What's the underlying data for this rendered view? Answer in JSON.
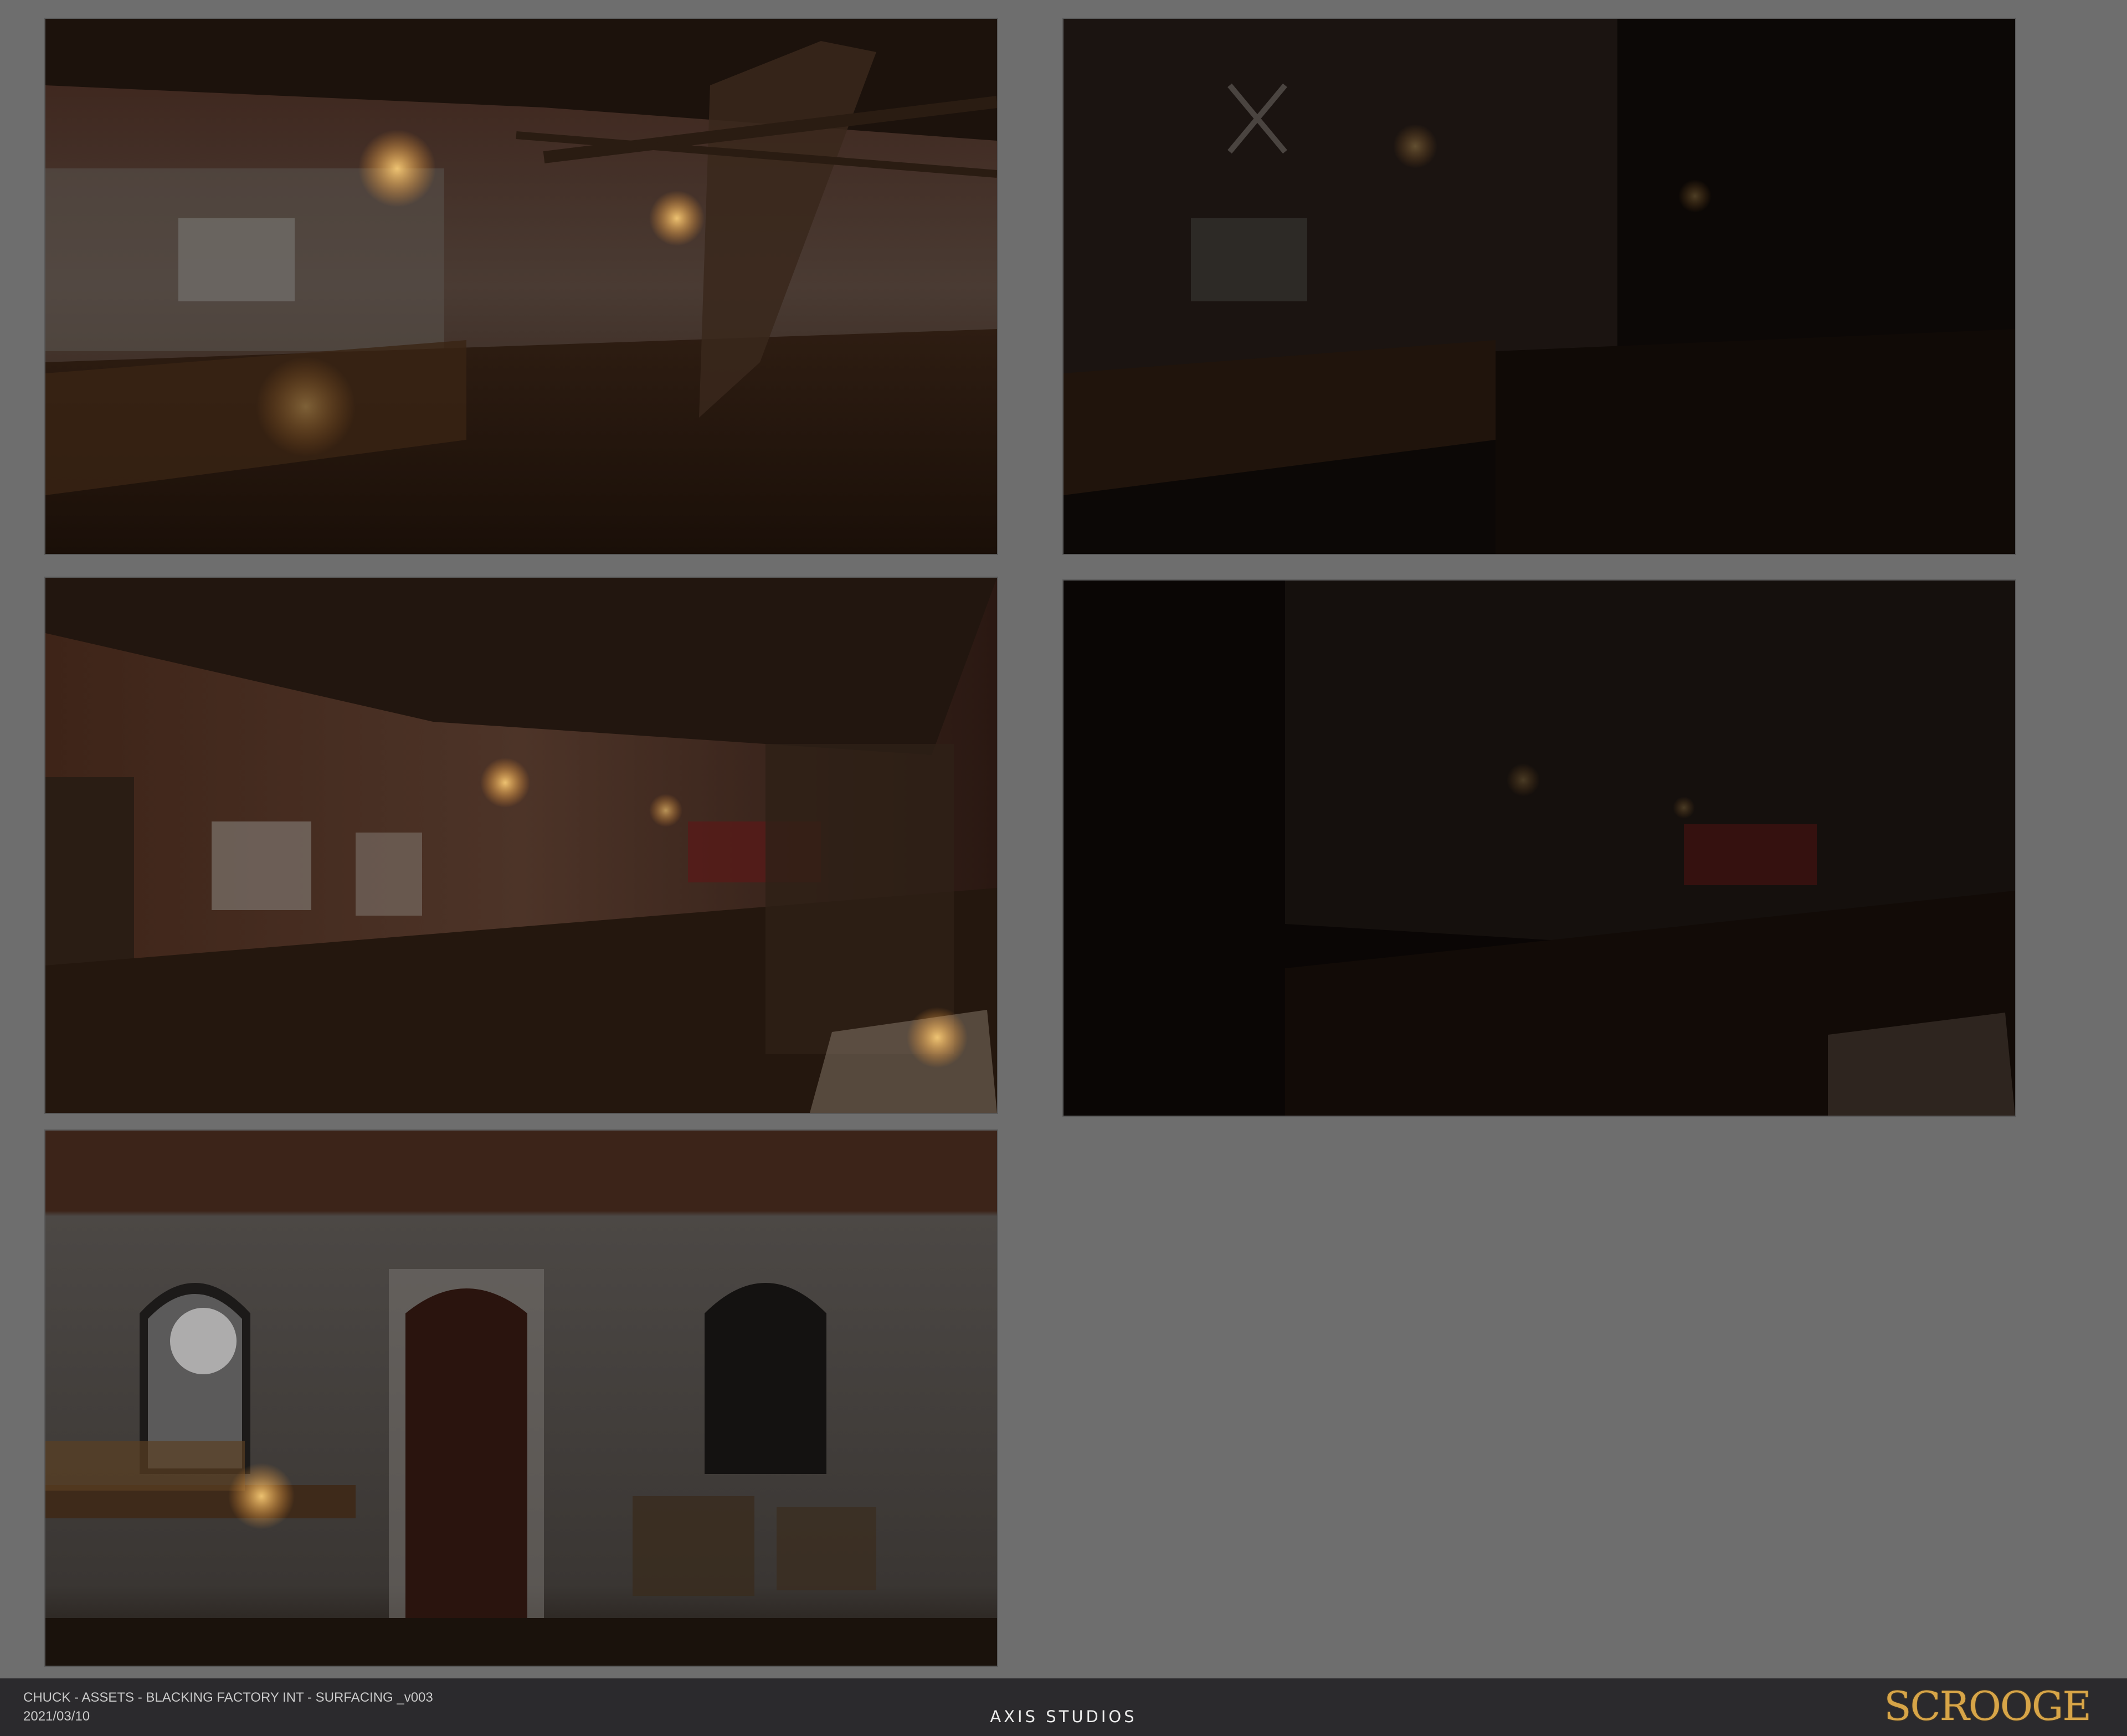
{
  "sheet": {
    "frames": [
      {
        "id": "frame-1",
        "name": "factory-interior-render-lit"
      },
      {
        "id": "frame-2",
        "name": "factory-interior-render-dark"
      },
      {
        "id": "frame-3",
        "name": "factory-wide-render-lit"
      },
      {
        "id": "frame-4",
        "name": "factory-wide-render-dark"
      },
      {
        "id": "frame-5",
        "name": "factory-wall-doorway-render"
      }
    ],
    "background_color": "#6e6e6e"
  },
  "footer": {
    "title": "CHUCK - ASSETS - BLACKING FACTORY INT - SURFACING _v003",
    "date": "2021/03/10",
    "studio": "AXIS STUDIOS",
    "logo_text": "SCROOGE",
    "logo_color": "#d7a548",
    "background_color": "#2b2a2d"
  }
}
